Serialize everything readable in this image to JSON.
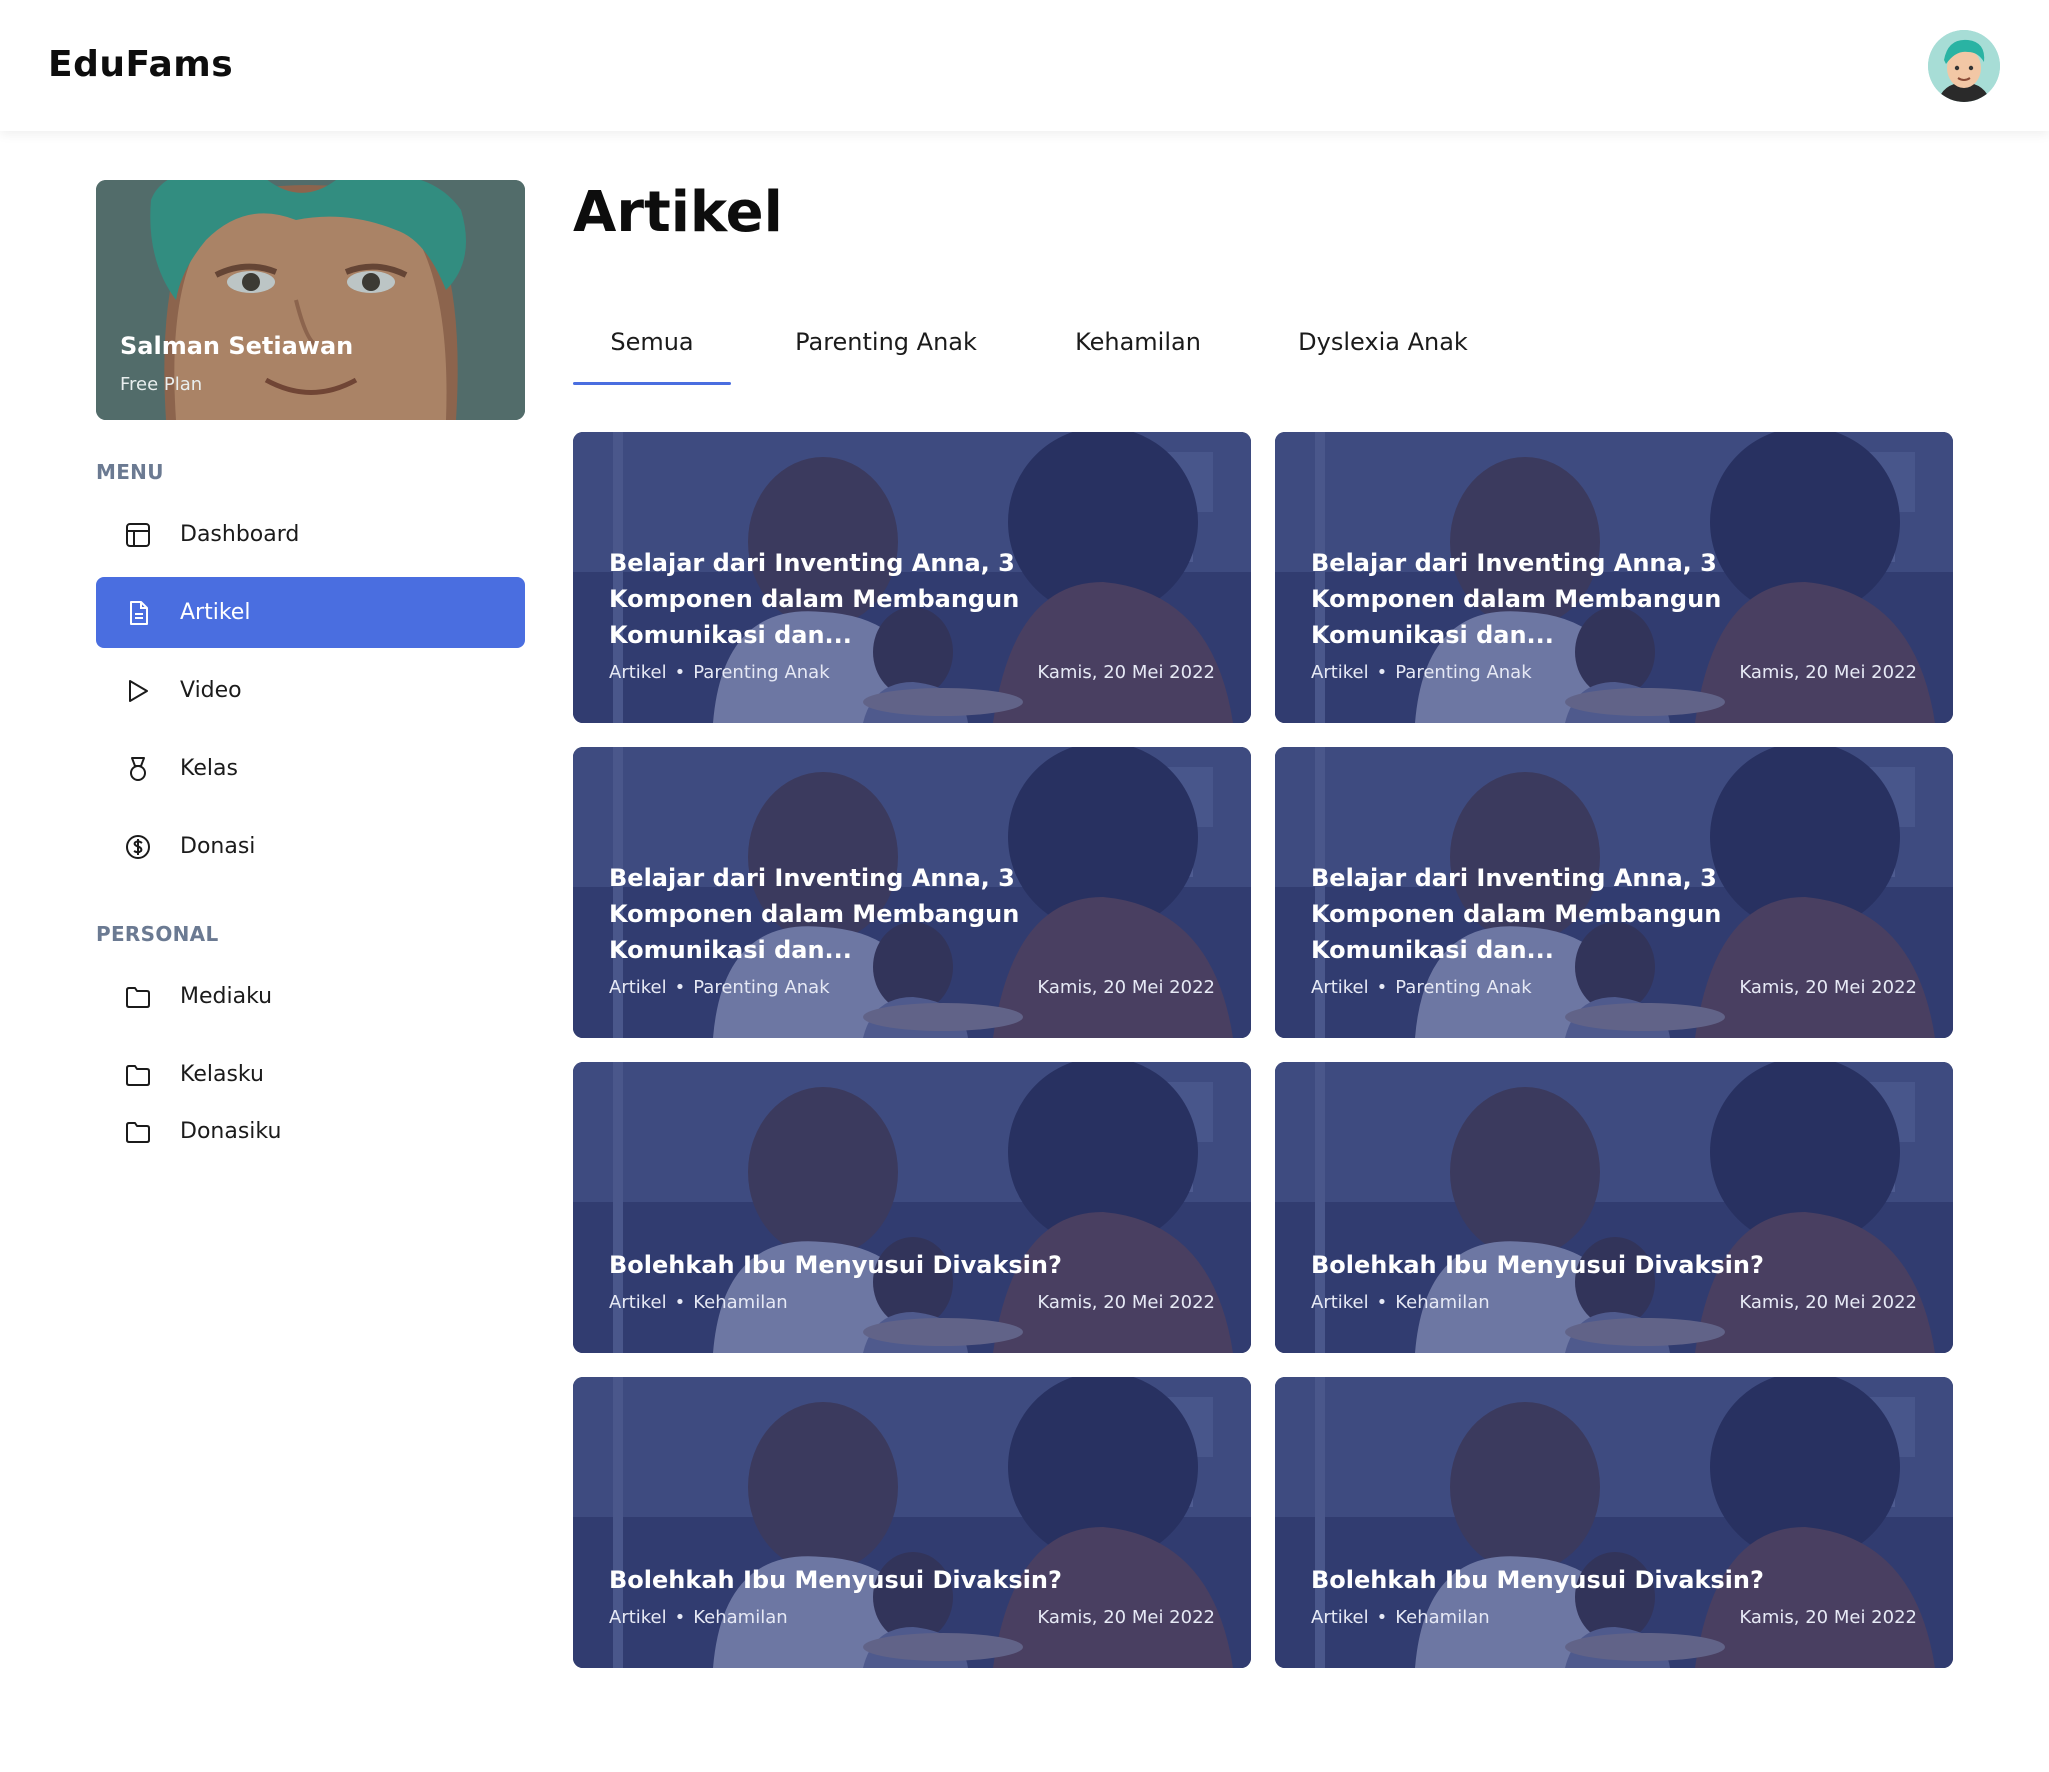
{
  "app": {
    "brand": "EduFams"
  },
  "profile": {
    "name": "Salman Setiawan",
    "plan": "Free Plan"
  },
  "sidebar": {
    "menu_label": "MENU",
    "menu_items": [
      {
        "label": "Dashboard",
        "icon": "layout-icon"
      },
      {
        "label": "Artikel",
        "icon": "document-icon",
        "active": true
      },
      {
        "label": "Video",
        "icon": "play-icon"
      },
      {
        "label": "Kelas",
        "icon": "medal-icon"
      },
      {
        "label": "Donasi",
        "icon": "dollar-circle-icon"
      }
    ],
    "personal_label": "PERSONAL",
    "personal_items": [
      {
        "label": "Mediaku",
        "icon": "folder-icon"
      },
      {
        "label": "Kelasku",
        "icon": "folder-icon"
      },
      {
        "label": "Donasiku",
        "icon": "folder-icon"
      }
    ]
  },
  "main": {
    "title": "Artikel",
    "tabs": [
      {
        "label": "Semua",
        "active": true
      },
      {
        "label": "Parenting Anak"
      },
      {
        "label": "Kehamilan"
      },
      {
        "label": "Dyslexia Anak"
      }
    ],
    "articles": [
      {
        "title": "Belajar dari Inventing Anna, 3 Komponen dalam Membangun Komunikasi dan...",
        "type": "Artikel",
        "category": "Parenting Anak",
        "date": "Kamis, 20 Mei 2022"
      },
      {
        "title": "Belajar dari Inventing Anna, 3 Komponen dalam Membangun Komunikasi dan...",
        "type": "Artikel",
        "category": "Parenting Anak",
        "date": "Kamis, 20 Mei 2022"
      },
      {
        "title": "Belajar dari Inventing Anna, 3 Komponen dalam Membangun Komunikasi dan...",
        "type": "Artikel",
        "category": "Parenting Anak",
        "date": "Kamis, 20 Mei 2022"
      },
      {
        "title": "Belajar dari Inventing Anna, 3 Komponen dalam Membangun Komunikasi dan...",
        "type": "Artikel",
        "category": "Parenting Anak",
        "date": "Kamis, 20 Mei 2022"
      },
      {
        "title": "Bolehkah Ibu Menyusui Divaksin?",
        "type": "Artikel",
        "category": "Kehamilan",
        "date": "Kamis, 20 Mei 2022"
      },
      {
        "title": "Bolehkah Ibu Menyusui Divaksin?",
        "type": "Artikel",
        "category": "Kehamilan",
        "date": "Kamis, 20 Mei 2022"
      },
      {
        "title": "Bolehkah Ibu Menyusui Divaksin?",
        "type": "Artikel",
        "category": "Kehamilan",
        "date": "Kamis, 20 Mei 2022"
      },
      {
        "title": "Bolehkah Ibu Menyusui Divaksin?",
        "type": "Artikel",
        "category": "Kehamilan",
        "date": "Kamis, 20 Mei 2022"
      }
    ]
  },
  "colors": {
    "accent": "#4a6ee0",
    "card_overlay": "#2c3a78",
    "section_label": "#6b7a92"
  }
}
